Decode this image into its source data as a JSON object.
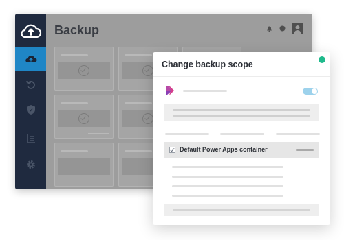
{
  "app": {
    "page_title": "Backup",
    "sidebar": {
      "items": [
        {
          "icon": "cloud-logo-icon"
        },
        {
          "icon": "cloud-upload-icon",
          "active": true
        },
        {
          "icon": "restore-icon"
        },
        {
          "icon": "shield-icon"
        },
        {
          "icon": "report-list-icon"
        },
        {
          "icon": "gear-icon"
        }
      ]
    },
    "header_icons": [
      "bell-icon",
      "help-icon",
      "account-icon"
    ]
  },
  "modal": {
    "title": "Change backup scope",
    "status_color": "#1fba8c",
    "app_icon": "power-apps-icon",
    "toggle_on": true,
    "container_label": "Default Power Apps container",
    "container_checked": true
  },
  "colors": {
    "sidebar_bg": "#1f2a3f",
    "sidebar_active": "#1f86c6",
    "toggle": "#9dd2ec",
    "power_apps_purple": "#8a3fb5",
    "power_apps_pink": "#d53f8c"
  }
}
